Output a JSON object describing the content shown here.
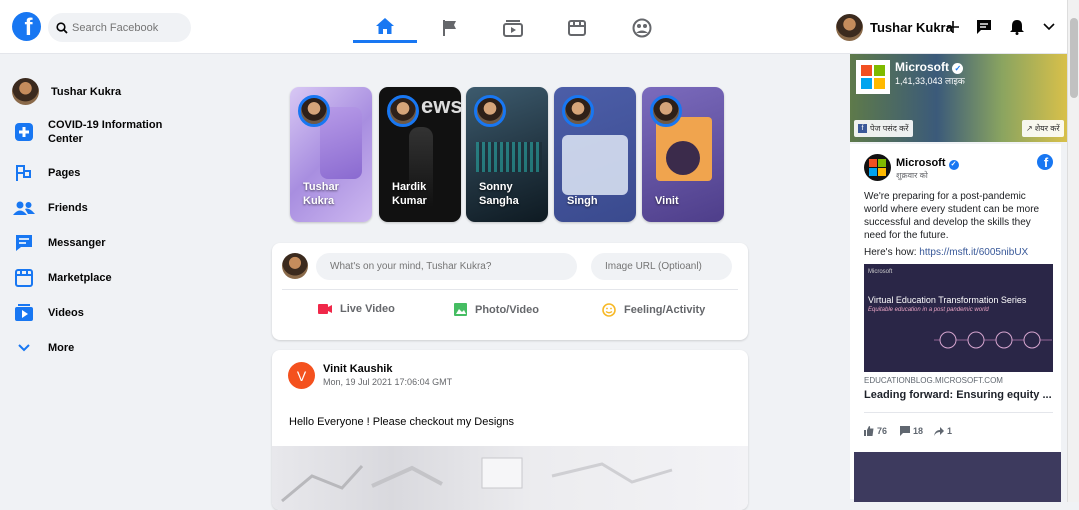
{
  "topbar": {
    "logo_letter": "f",
    "search_placeholder": "Search Facebook",
    "user_name": "Tushar Kukra"
  },
  "sidebar": {
    "items": [
      {
        "label": "Tushar Kukra",
        "icon": "avatar"
      },
      {
        "label": "COVID-19 Information Center",
        "icon": "plus-icon"
      },
      {
        "label": "Pages",
        "icon": "flag-icon"
      },
      {
        "label": "Friends",
        "icon": "friends-icon"
      },
      {
        "label": "Messanger",
        "icon": "message-icon"
      },
      {
        "label": "Marketplace",
        "icon": "store-icon"
      },
      {
        "label": "Videos",
        "icon": "video-icon"
      },
      {
        "label": "More",
        "icon": "chevron-down-icon"
      }
    ]
  },
  "stories": [
    {
      "name": "Tushar Kukra",
      "color": "#b9a6e6"
    },
    {
      "name": "Hardik Kumar",
      "color": "#1a1a1a"
    },
    {
      "name": "Sonny Sangha",
      "color": "#2d4a5a"
    },
    {
      "name": "Singh",
      "color": "#4a5aa0"
    },
    {
      "name": "Vinit",
      "color": "#5a4a8a"
    }
  ],
  "composer": {
    "status_placeholder": "What's on your mind, Tushar Kukra?",
    "image_placeholder": "Image URL (Optioanl)",
    "actions": [
      {
        "label": "Live Video",
        "color": "#f02849"
      },
      {
        "label": "Photo/Video",
        "color": "#45bd62"
      },
      {
        "label": "Feeling/Activity",
        "color": "#f7b928"
      }
    ]
  },
  "post": {
    "avatar_letter": "V",
    "author": "Vinit Kaushik",
    "date": "Mon, 19 Jul 2021 17:06:04 GMT",
    "text": "Hello Everyone ! Please checkout my Designs"
  },
  "ad": {
    "banner_title": "Microsoft",
    "banner_likes": "1,41,33,043 लाइक",
    "like_page_button": "पेज पसंद करें",
    "share_button": "शेयर करें",
    "page_name": "Microsoft",
    "sponsored": "शुक्रवार को",
    "body": "We're preparing for a post-pandemic world where every student can be more successful and develop the skills they need for the future.",
    "heres_how": "Here's how:",
    "link": "https://msft.it/6005nibUX",
    "preview_brand": "Microsoft",
    "preview_title": "Virtual Education Transformation Series",
    "preview_subtitle": "Equitable education in a post pandemic world",
    "domain": "EDUCATIONBLOG.MICROSOFT.COM",
    "headline": "Leading forward: Ensuring equity ...",
    "likes": "76",
    "comments": "18",
    "shares": "1"
  },
  "colors": {
    "brand": "#1877f2",
    "background": "#f0f2f5"
  }
}
